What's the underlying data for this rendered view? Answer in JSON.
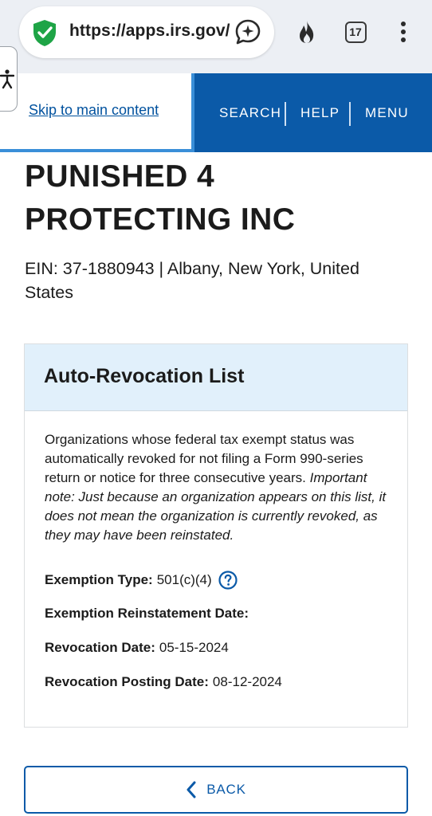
{
  "browser": {
    "url": "https://apps.irs.gov/",
    "tab_count": "17",
    "icons": [
      "shield-check-icon",
      "ai-sparkle-icon",
      "flame-icon",
      "tab-switcher-icon",
      "overflow-menu-icon"
    ]
  },
  "header": {
    "skip_link": "Skip to main content",
    "nav": {
      "search": "SEARCH",
      "help": "HELP",
      "menu": "MENU"
    }
  },
  "organization": {
    "name_line1": "PUNISHED 4",
    "name_line2": "PROTECTING INC",
    "ein_location": "EIN: 37-1880943 | Albany, New York, United States"
  },
  "card": {
    "title": "Auto-Revocation List",
    "description": "Organizations whose federal tax exempt status was automatically revoked for not filing a Form 990-series return or notice for three consecutive years.",
    "note": "Important note: Just because an organization appears on this list, it does not mean the organization is currently revoked, as they may have been reinstated.",
    "fields": {
      "exemption_type": {
        "label": "Exemption Type:",
        "value": "501(c)(4)"
      },
      "reinstatement_date": {
        "label": "Exemption Reinstatement Date:",
        "value": ""
      },
      "revocation_date": {
        "label": "Revocation Date:",
        "value": "05-15-2024"
      },
      "posting_date": {
        "label": "Revocation Posting Date:",
        "value": "08-12-2024"
      }
    }
  },
  "back_button": {
    "label": "BACK"
  },
  "colors": {
    "nav_blue": "#0b5aa8",
    "link_blue": "#00519e",
    "card_header_bg": "#e1f0fb",
    "shield_green": "#1ea446"
  }
}
